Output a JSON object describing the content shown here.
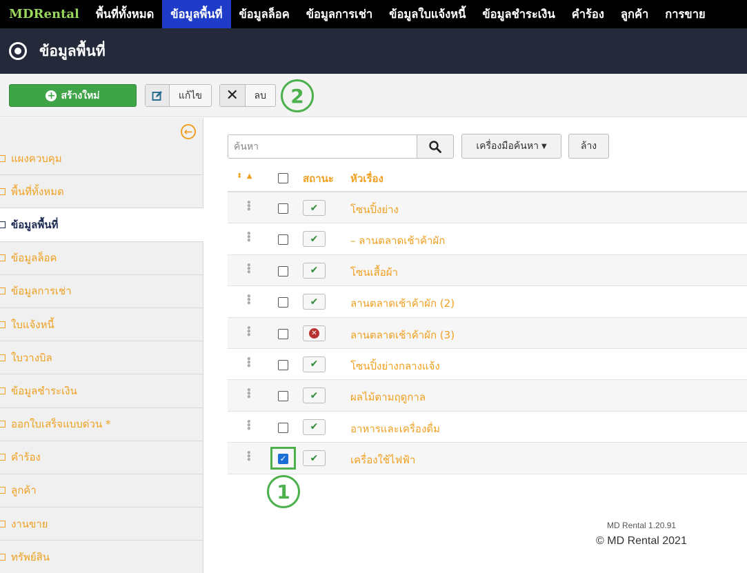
{
  "nav": {
    "brand": "MDRental",
    "items": [
      {
        "label": "พื้นที่ทั้งหมด"
      },
      {
        "label": "ข้อมูลพื้นที่"
      },
      {
        "label": "ข้อมูลล็อค"
      },
      {
        "label": "ข้อมูลการเช่า"
      },
      {
        "label": "ข้อมูลใบแจ้งหนี้"
      },
      {
        "label": "ข้อมูลชำระเงิน"
      },
      {
        "label": "คำร้อง"
      },
      {
        "label": "ลูกค้า"
      },
      {
        "label": "การขาย"
      }
    ],
    "active_index": 1
  },
  "header": {
    "title": "ข้อมูลพื้นที่"
  },
  "toolbar": {
    "new_label": "สร้างใหม่",
    "edit_label": "แก้ไข",
    "delete_label": "ลบ"
  },
  "callouts": {
    "one": "1",
    "two": "2"
  },
  "sidebar": {
    "items": [
      {
        "label": "แผงควบคุม"
      },
      {
        "label": "พื้นที่ทั้งหมด"
      },
      {
        "label": "ข้อมูลพื้นที่"
      },
      {
        "label": "ข้อมูลล็อค"
      },
      {
        "label": "ข้อมูลการเช่า"
      },
      {
        "label": "ใบแจ้งหนี้"
      },
      {
        "label": "ใบวางบิล"
      },
      {
        "label": "ข้อมูลชำระเงิน"
      },
      {
        "label": "ออกใบเสร็จแบบด่วน *"
      },
      {
        "label": "คำร้อง"
      },
      {
        "label": "ลูกค้า"
      },
      {
        "label": "งานขาย"
      },
      {
        "label": "ทรัพย์สิน"
      }
    ],
    "active_index": 2
  },
  "search": {
    "placeholder": "ค้นหา",
    "tools_label": "เครื่องมือค้นหา",
    "clear_label": "ล้าง"
  },
  "table": {
    "columns": {
      "status": "สถานะ",
      "title": "หัวเรื่อง"
    },
    "rows": [
      {
        "title": "โซนปิ้งย่าง",
        "status": "published",
        "checked": false
      },
      {
        "title": "–  ลานตลาดเช้าค้าผัก",
        "status": "published",
        "checked": false
      },
      {
        "title": "โซนเสื้อผ้า",
        "status": "published",
        "checked": false
      },
      {
        "title": "ลานตลาดเช้าค้าผัก (2)",
        "status": "published",
        "checked": false
      },
      {
        "title": "ลานตลาดเช้าค้าผัก (3)",
        "status": "unpublished",
        "checked": false
      },
      {
        "title": "โซนปิ้งย่างกลางแจ้ง",
        "status": "published",
        "checked": false
      },
      {
        "title": "ผลไม้ตามฤดูกาล",
        "status": "published",
        "checked": false
      },
      {
        "title": "อาหารและเครื่องดื่ม",
        "status": "published",
        "checked": false
      },
      {
        "title": "เครื่องใช้ไฟฟ้า",
        "status": "published",
        "checked": true
      }
    ]
  },
  "footer": {
    "version": "MD Rental 1.20.91",
    "copyright": "© MD Rental 2021"
  },
  "colors": {
    "accent": "#f0a020",
    "nav_active": "#1f3cc8",
    "header_bg": "#252a3a",
    "new_button": "#3fa448",
    "callout": "#4cb04c"
  }
}
